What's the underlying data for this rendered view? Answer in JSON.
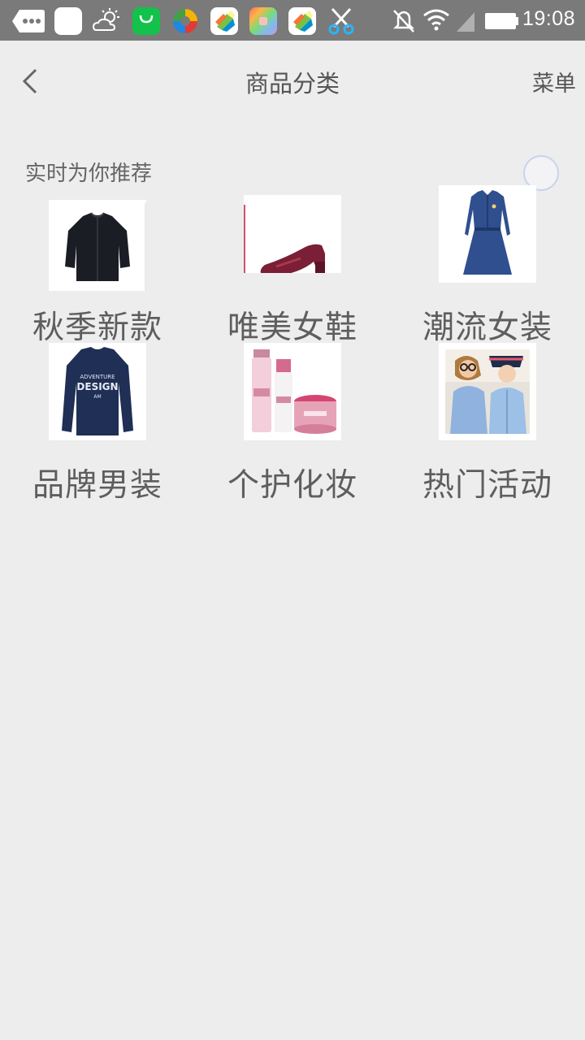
{
  "status_bar": {
    "time": "19:08",
    "icons_left": [
      "chat-more-icon",
      "white-app-icon",
      "weather-icon",
      "shopping-bag-icon",
      "browser-icon",
      "app-icon",
      "photo-app-icon",
      "app-icon",
      "scissors-icon"
    ],
    "icons_right": [
      "notifications-off-icon",
      "wifi-icon",
      "signal-icon",
      "battery-icon"
    ]
  },
  "header": {
    "title": "商品分类",
    "menu_label": "菜单"
  },
  "section": {
    "title": "实时为你推荐"
  },
  "categories": [
    {
      "label": "秋季新款",
      "image": "black-cardigan"
    },
    {
      "label": "唯美女鞋",
      "image": "burgundy-flat-shoe"
    },
    {
      "label": "潮流女装",
      "image": "denim-dress"
    },
    {
      "label": "品牌男装",
      "image": "navy-long-sleeve-tee"
    },
    {
      "label": "个护化妆",
      "image": "pink-skincare-set"
    },
    {
      "label": "热门活动",
      "image": "two-women-photo"
    }
  ]
}
